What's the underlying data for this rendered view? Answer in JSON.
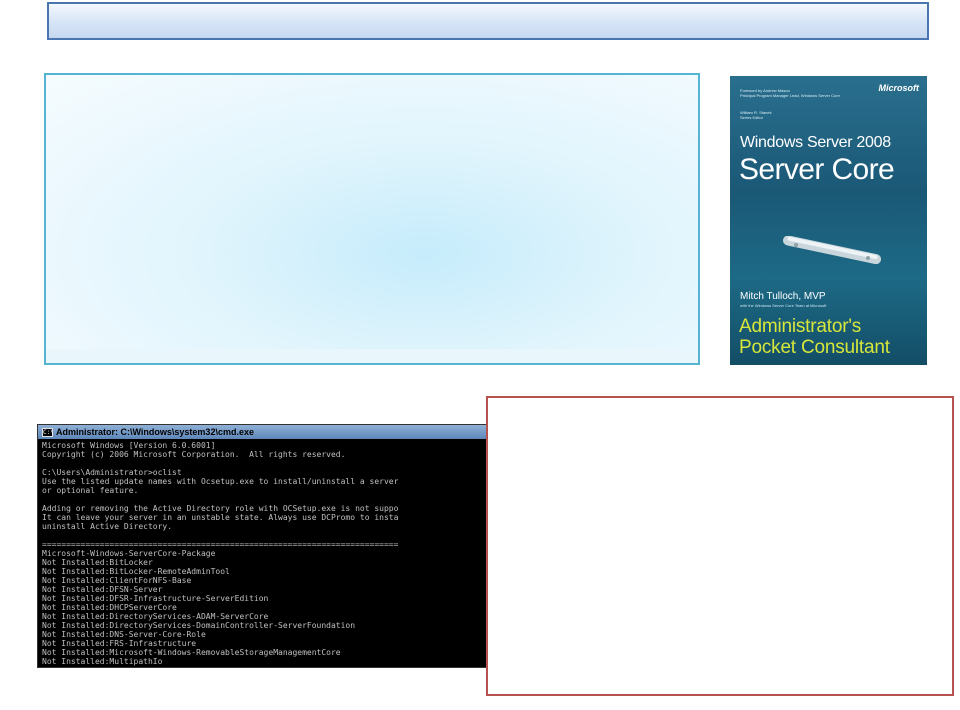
{
  "book": {
    "publisher": "Microsoft",
    "foreword": "Foreword by Andrew Mason",
    "foreword_role": "Principal Program Manager Lead, Windows Server Core",
    "series_editor": "William R. Stanek",
    "series_editor_role": "Series Editor",
    "title_line1": "Windows Server 2008",
    "title_line2": "Server Core",
    "author": "Mitch Tulloch, MVP",
    "author_team": "with the Windows Server Core Team at Microsoft",
    "subtitle_line1": "Administrator's",
    "subtitle_line2": "Pocket Consultant"
  },
  "cmd": {
    "window_title": "Administrator: C:\\Windows\\system32\\cmd.exe",
    "icon_glyph": "C:\\",
    "lines": [
      "Microsoft Windows [Version 6.0.6001]",
      "Copyright (c) 2006 Microsoft Corporation.  All rights reserved.",
      "",
      "C:\\Users\\Administrator>oclist",
      "Use the listed update names with Ocsetup.exe to install/uninstall a server",
      "or optional feature.",
      "",
      "Adding or removing the Active Directory role with OCSetup.exe is not suppo",
      "It can leave your server in an unstable state. Always use DCPromo to insta",
      "uninstall Active Directory.",
      "",
      "==========================================================================",
      "Microsoft-Windows-ServerCore-Package",
      "Not Installed:BitLocker",
      "Not Installed:BitLocker-RemoteAdminTool",
      "Not Installed:ClientForNFS-Base",
      "Not Installed:DFSN-Server",
      "Not Installed:DFSR-Infrastructure-ServerEdition",
      "Not Installed:DHCPServerCore",
      "Not Installed:DirectoryServices-ADAM-ServerCore",
      "Not Installed:DirectoryServices-DomainController-ServerFoundation",
      "Not Installed:DNS-Server-Core-Role",
      "Not Installed:FRS-Infrastructure",
      "Not Installed:Microsoft-Windows-RemovableStorageManagementCore",
      "Not Installed:MultipathIo"
    ]
  }
}
